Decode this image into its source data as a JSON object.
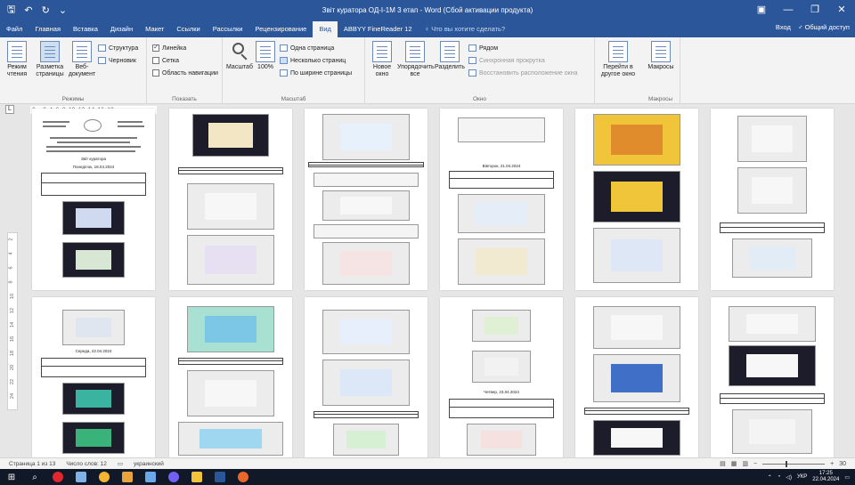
{
  "titlebar": {
    "qat_save": "🖫",
    "qat_undo": "↶",
    "qat_redo": "↻",
    "qat_more": "⌄",
    "title": "Звіт куратора ОД-І-1М 3 етап - Word (Сбой активации продукта)",
    "btn_account": "▣",
    "btn_min": "—",
    "btn_max": "❐",
    "btn_close": "✕"
  },
  "tabs": [
    "Файл",
    "Главная",
    "Вставка",
    "Дизайн",
    "Макет",
    "Ссылки",
    "Рассылки",
    "Рецензирование",
    "Вид",
    "ABBYY FineReader 12"
  ],
  "active_tab": "Вид",
  "tell_me": "♀ Что вы хотите сделать?",
  "sign_in": "Вход",
  "share": "♂ Общий доступ",
  "ribbon": {
    "modes": {
      "label": "Режимы",
      "read": "Режим чтения",
      "layout": "Разметка страницы",
      "web": "Веб-документ",
      "outline": "Структура",
      "draft": "Черновик"
    },
    "show": {
      "label": "Показать",
      "ruler": "Линейка",
      "grid": "Сетка",
      "nav": "Область навигации"
    },
    "zoom": {
      "label": "Масштаб",
      "zoom": "Масштаб",
      "hundred": "100%",
      "one_page": "Одна страница",
      "multi": "Несколько страниц",
      "width": "По ширине страницы"
    },
    "window": {
      "label": "Окно",
      "new": "Новое окно",
      "arrange": "Упорядочить все",
      "split": "Разделить",
      "side": "Рядом",
      "sync": "Синхронная прокрутка",
      "reset": "Восстановить расположение окна",
      "switch": "Перейти в другое окно"
    },
    "macros": {
      "label": "Макросы",
      "macros": "Макросы"
    }
  },
  "ruler_text": "2 ⌵ 2  4  6  8  10  12  14  16  18",
  "vruler_marks": [
    "2",
    "4",
    "6",
    "8",
    "10",
    "12",
    "14",
    "16",
    "18",
    "20",
    "22",
    "24"
  ],
  "pages_text": {
    "p1_heading": "Звіт куратора",
    "p1_date": "Понеділок, 18.04.2024",
    "p4_date": "Вівторок, 21.04.2024",
    "p7_date": "Середа, 22.04.2024",
    "p10_date": "Четвер, 23.04.2024"
  },
  "statusbar": {
    "page": "Страница 1 из 13",
    "words": "Число слов: 12",
    "lang": "украинский",
    "zoom_minus": "−",
    "zoom_plus": "+",
    "zoom_level": "30"
  },
  "taskbar": {
    "clock_time": "17:25",
    "clock_date": "22.04.2024",
    "lang": "УКР"
  },
  "colors": {
    "brand": "#2b579a",
    "taskbar": "#111827"
  }
}
